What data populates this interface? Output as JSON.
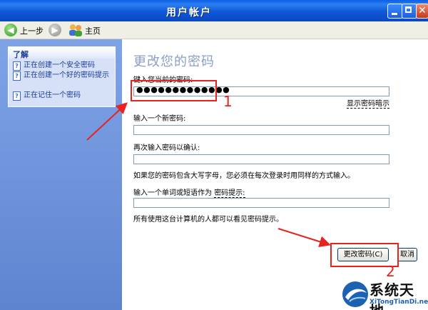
{
  "window": {
    "title": "用户帐户"
  },
  "toolbar": {
    "back_label": "上一步",
    "home_label": "主页"
  },
  "help_panel": {
    "title": "了解",
    "items": [
      {
        "label": "正在创建一个安全密码"
      },
      {
        "label": "正在创建一个好的密码提示"
      },
      {
        "label": "正在记住一个密码"
      }
    ]
  },
  "main": {
    "heading": "更改您的密码",
    "current_password_label": "键入您当前的密码:",
    "current_password_value": "●●●●●●●●●●●●●",
    "show_hint_link": "显示密码暗示",
    "new_password_label": "输入一个新密码:",
    "confirm_label": "再次输入密码以确认:",
    "caps_note": "如果您的密码包含大写字母，您必须在每次登录时用同样的方式输入。",
    "hint_label_prefix": "输入一个单词或短语作为",
    "hint_label_link": "密码提示:",
    "hint_note": "所有使用这台计算机的人都可以看见密码提示。",
    "change_button": "更改密码(C)",
    "cancel_button": "取消"
  },
  "annotations": {
    "step1": "1",
    "step2": "2",
    "highlight_color": "#e8231f"
  },
  "watermark": {
    "name": "系统天地",
    "url": "XiTongTianDi.net"
  }
}
